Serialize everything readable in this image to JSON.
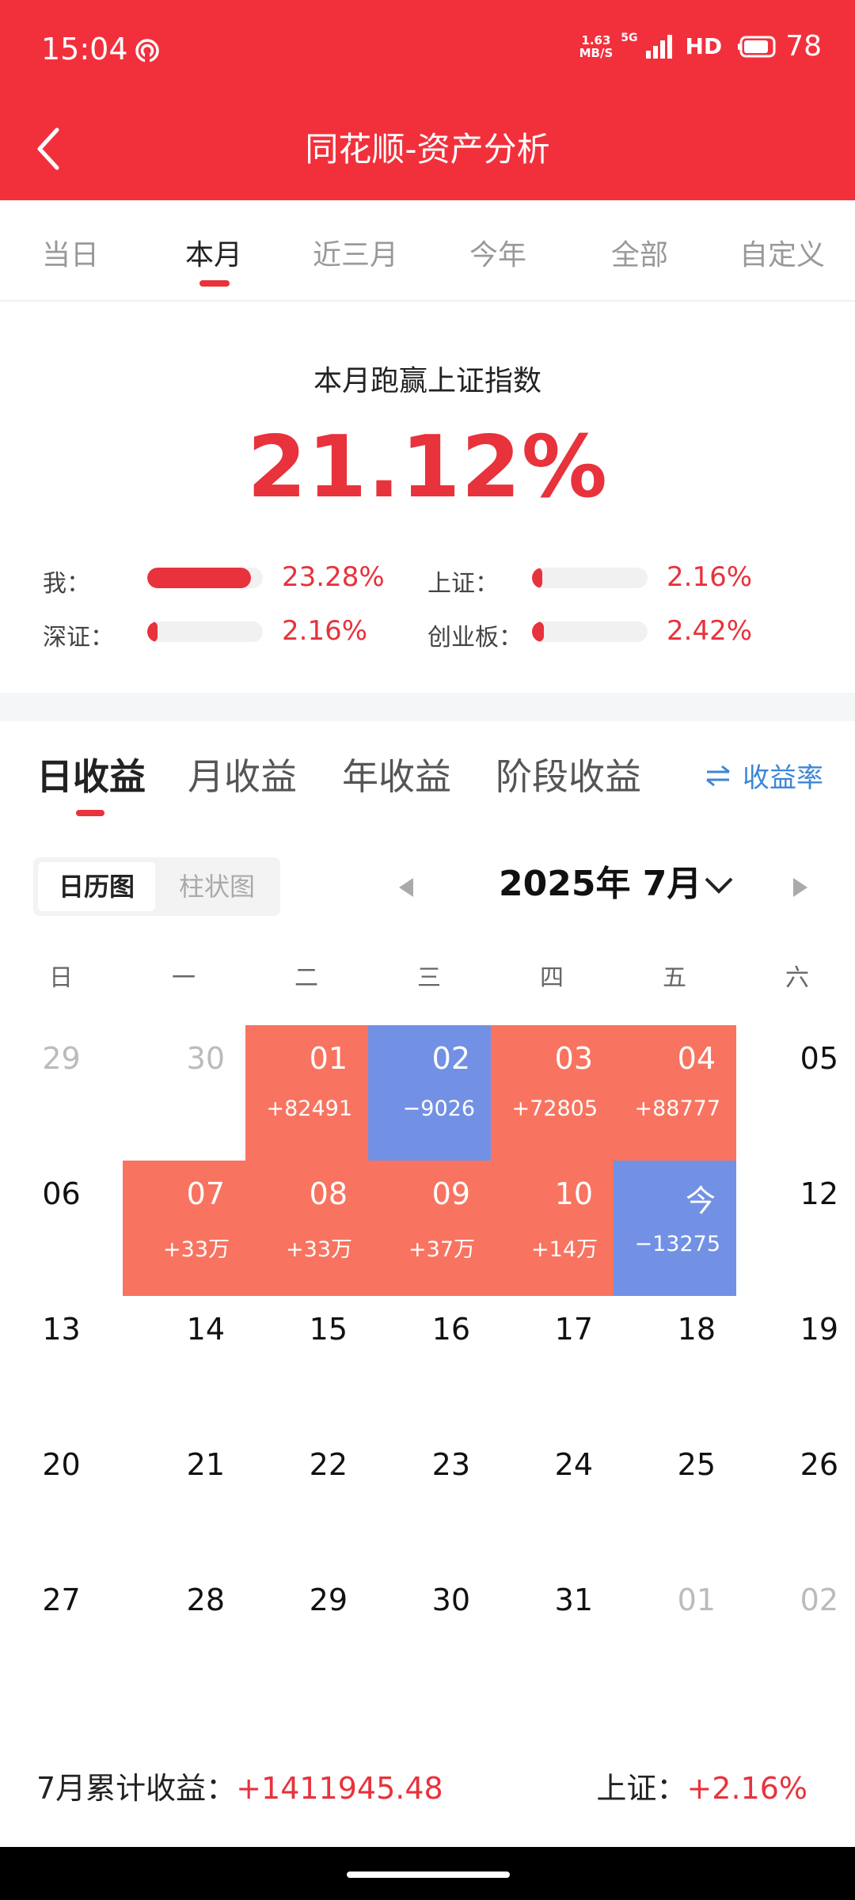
{
  "status_bar": {
    "time": "15:04",
    "speed_value": "1.63",
    "speed_unit": "MB/S",
    "network": "5G",
    "hd": "HD",
    "battery": "78",
    "icons": [
      "hotspot-icon",
      "signal-icon",
      "battery-icon"
    ]
  },
  "header": {
    "title": "同花顺-资产分析",
    "back_icon": "chevron-left-icon"
  },
  "period_tabs": [
    "当日",
    "本月",
    "近三月",
    "今年",
    "全部",
    "自定义"
  ],
  "period_active": "本月",
  "summary": {
    "title": "本月跑赢上证指数",
    "value": "21.12%",
    "compare": [
      {
        "label": "我：",
        "value": "23.28%",
        "fill": 0.9
      },
      {
        "label": "上证：",
        "value": "2.16%",
        "fill": 0.09
      },
      {
        "label": "深证：",
        "value": "2.16%",
        "fill": 0.09
      },
      {
        "label": "创业板：",
        "value": "2.42%",
        "fill": 0.1
      }
    ]
  },
  "income_tabs": [
    "日收益",
    "月收益",
    "年收益",
    "阶段收益"
  ],
  "income_active": "日收益",
  "rate_toggle": "收益率",
  "view_switch": {
    "calendar": "日历图",
    "bar": "柱状图",
    "active": "日历图"
  },
  "month": {
    "label": "2025年 7月"
  },
  "weekdays": [
    "日",
    "一",
    "二",
    "三",
    "四",
    "五",
    "六"
  ],
  "calendar": [
    [
      {
        "d": "29",
        "muted": true
      },
      {
        "d": "30",
        "muted": true
      },
      {
        "d": "01",
        "v": "+82491",
        "s": "gain"
      },
      {
        "d": "02",
        "v": "−9026",
        "s": "loss"
      },
      {
        "d": "03",
        "v": "+72805",
        "s": "gain"
      },
      {
        "d": "04",
        "v": "+88777",
        "s": "gain"
      },
      {
        "d": "05"
      }
    ],
    [
      {
        "d": "06"
      },
      {
        "d": "07",
        "v": "+33万",
        "s": "gain"
      },
      {
        "d": "08",
        "v": "+33万",
        "s": "gain"
      },
      {
        "d": "09",
        "v": "+37万",
        "s": "gain"
      },
      {
        "d": "10",
        "v": "+14万",
        "s": "gain"
      },
      {
        "d": "今",
        "v": "−13275",
        "s": "loss"
      },
      {
        "d": "12"
      }
    ],
    [
      {
        "d": "13"
      },
      {
        "d": "14"
      },
      {
        "d": "15"
      },
      {
        "d": "16"
      },
      {
        "d": "17"
      },
      {
        "d": "18"
      },
      {
        "d": "19"
      }
    ],
    [
      {
        "d": "20"
      },
      {
        "d": "21"
      },
      {
        "d": "22"
      },
      {
        "d": "23"
      },
      {
        "d": "24"
      },
      {
        "d": "25"
      },
      {
        "d": "26"
      }
    ],
    [
      {
        "d": "27"
      },
      {
        "d": "28"
      },
      {
        "d": "29"
      },
      {
        "d": "30"
      },
      {
        "d": "31"
      },
      {
        "d": "01",
        "muted": true
      },
      {
        "d": "02",
        "muted": true
      }
    ]
  ],
  "footer": {
    "cum_label": "7月累计收益：",
    "cum_value": "+1411945.48",
    "index_label": "上证：",
    "index_value": "+2.16%"
  },
  "colors": {
    "brand_red": "#f2303c",
    "gain": "#f87460",
    "loss": "#7291e4",
    "link_blue": "#3e86d6"
  }
}
